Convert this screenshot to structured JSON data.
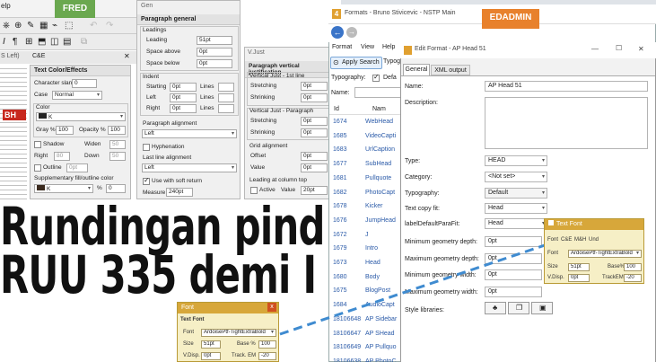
{
  "left_app": {
    "menu_fragment": "elp",
    "fred_tag": "FRED",
    "fred_color": "#6aa84f",
    "tab_label": "C&E",
    "side_label": "S Left)",
    "article_headline": {
      "line1": "Rundingan pind",
      "line2": "RUU 335 demi I"
    },
    "red_badge": "BH"
  },
  "color_panel": {
    "title": "Text Color/Effects",
    "char_slant_label": "Character slant",
    "char_slant_value": "0",
    "case_label": "Case",
    "case_value": "Normal",
    "color_group": "Color",
    "color_value": "K",
    "gray_label": "Gray %",
    "gray_value": "100",
    "opacity_label": "Opacity %",
    "opacity_value": "100",
    "shadow_label": "Shadow",
    "widen_label": "Widen",
    "widen_value": "50",
    "right_label": "Right",
    "right_value": "80",
    "down_label": "Down",
    "down_value": "50",
    "outline_label": "Outline",
    "outline_value": "0pt",
    "supp_label": "Supplementary fill/outline color",
    "supp_color": "K",
    "supp_percent": "%",
    "supp_value": "0"
  },
  "gen_panel": {
    "tab": "Gen",
    "title": "Paragraph general",
    "leadings_group": "Leadings",
    "leading_label": "Leading",
    "leading_value": "51pt",
    "space_above_label": "Space above",
    "space_above_value": "0pt",
    "space_below_label": "Space below",
    "space_below_value": "0pt",
    "indent_group": "Indent",
    "starting_label": "Starting",
    "starting_value": "0pt",
    "starting_lines": "Lines",
    "left_label": "Left",
    "left_value": "0pt",
    "left_lines": "Lines",
    "right_label": "Right",
    "right_value": "0pt",
    "right_lines": "Lines",
    "align_group": "Paragraph alignment",
    "align_value": "Left",
    "hyphenation_label": "Hyphenation",
    "last_line_group": "Last line alignment",
    "last_line_value": "Left",
    "soft_return_label": "Use with soft return",
    "measure_label": "Measure",
    "measure_value": "240pt"
  },
  "vjust_panel": {
    "tab": "V.Just",
    "title": "Paragraph vertical justification",
    "group1": "Vertical Just - 1st line",
    "stretch1_label": "Stretching",
    "stretch1_value": "0pt",
    "shrink1_label": "Shrinking",
    "shrink1_value": "0pt",
    "group2": "Vertical Just - Paragraph",
    "stretch2_label": "Stretching",
    "stretch2_value": "0pt",
    "shrink2_label": "Shrinking",
    "shrink2_value": "0pt",
    "grid_group": "Grid alignment",
    "offset_label": "Offset",
    "offset_value": "0pt",
    "value_label": "Value",
    "value_value": "0pt",
    "column_group": "Leading at column top",
    "active_label": "Active",
    "col_value_label": "Value",
    "col_value": "20pt"
  },
  "formats_window": {
    "title": "Formats - Bruno Stivicevic - NSTP Main",
    "edadmin_tag": "EDADMIN",
    "edadmin_color": "#e8812c",
    "menu": [
      "Format",
      "View",
      "Help"
    ],
    "apply_search": "Apply Search",
    "typography_fragment": "Typog",
    "typography_label": "Typography:",
    "default_fragment": "Defa",
    "name_label": "Name:",
    "col_id": "Id",
    "col_name": "Nam",
    "rows": [
      {
        "id": "1674",
        "name": "WebHead"
      },
      {
        "id": "1685",
        "name": "VideoCapti"
      },
      {
        "id": "1683",
        "name": "UrlCaption"
      },
      {
        "id": "1677",
        "name": "SubHead"
      },
      {
        "id": "1681",
        "name": "Pullquote"
      },
      {
        "id": "1682",
        "name": "PhotoCapt"
      },
      {
        "id": "1678",
        "name": "Kicker"
      },
      {
        "id": "1676",
        "name": "JumpHead"
      },
      {
        "id": "1672",
        "name": "J"
      },
      {
        "id": "1679",
        "name": "Intro"
      },
      {
        "id": "1673",
        "name": "Head"
      },
      {
        "id": "1680",
        "name": "Body"
      },
      {
        "id": "1675",
        "name": "BlogPost"
      },
      {
        "id": "1684",
        "name": "AudioCapt"
      },
      {
        "id": "18106648",
        "name": "AP Sidebar"
      },
      {
        "id": "18106647",
        "name": "AP SHead"
      },
      {
        "id": "18106649",
        "name": "AP Pullquo"
      },
      {
        "id": "18106638",
        "name": "AP PhotoC"
      }
    ]
  },
  "edit_format": {
    "title": "Edit Format - AP Head 51",
    "tabs": [
      "General",
      "XML output"
    ],
    "name_label": "Name:",
    "name_value": "AP Head 51",
    "description_label": "Description:",
    "type_label": "Type:",
    "type_value": "HEAD",
    "category_label": "Category:",
    "category_value": "<Not set>",
    "typography_label": "Typography:",
    "typography_value": "Default",
    "text_copy_label": "Text copy fit:",
    "text_copy_value": "Head",
    "label_default_label": "labelDefaultParaFit:",
    "label_default_value": "Head",
    "min_depth_label": "Minimum geometry depth:",
    "min_depth_value": "0pt",
    "max_depth_label": "Maximum geometry depth:",
    "max_depth_value": "0pt",
    "min_width_label": "Minimum geometry width:",
    "min_width_value": "0pt",
    "max_width_label": "Maximum geometry width:",
    "max_width_value": "0pt",
    "style_libraries_label": "Style libraries:",
    "win_minimize": "—",
    "win_maximize": "☐",
    "win_close": "✕"
  },
  "text_font_right": {
    "title": "Text Font",
    "tabs": [
      "Font",
      "C&E",
      "M&H",
      "Und"
    ],
    "font_label": "Font",
    "font_value": "ArdoisePtf-TightExtraBold",
    "size_label": "Size",
    "size_value": "51pt",
    "base_label": "Base%",
    "base_value": "100",
    "vdisp_label": "V.Disp.",
    "vdisp_value": "0pt",
    "track_label": "TrackEM",
    "track_value": "-20"
  },
  "text_font_bottom": {
    "window_title": "Font",
    "close_glyph": "x",
    "section": "Text Font",
    "font_label": "Font",
    "font_value": "ArdoisePtf-TightExtraBold",
    "size_label": "Size",
    "size_value": "51pt",
    "base_label": "Base %",
    "base_value": "100",
    "vdisp_label": "V.Disp.",
    "vdisp_value": "0pt",
    "track_label": "Track. EM",
    "track_value": "-20"
  }
}
